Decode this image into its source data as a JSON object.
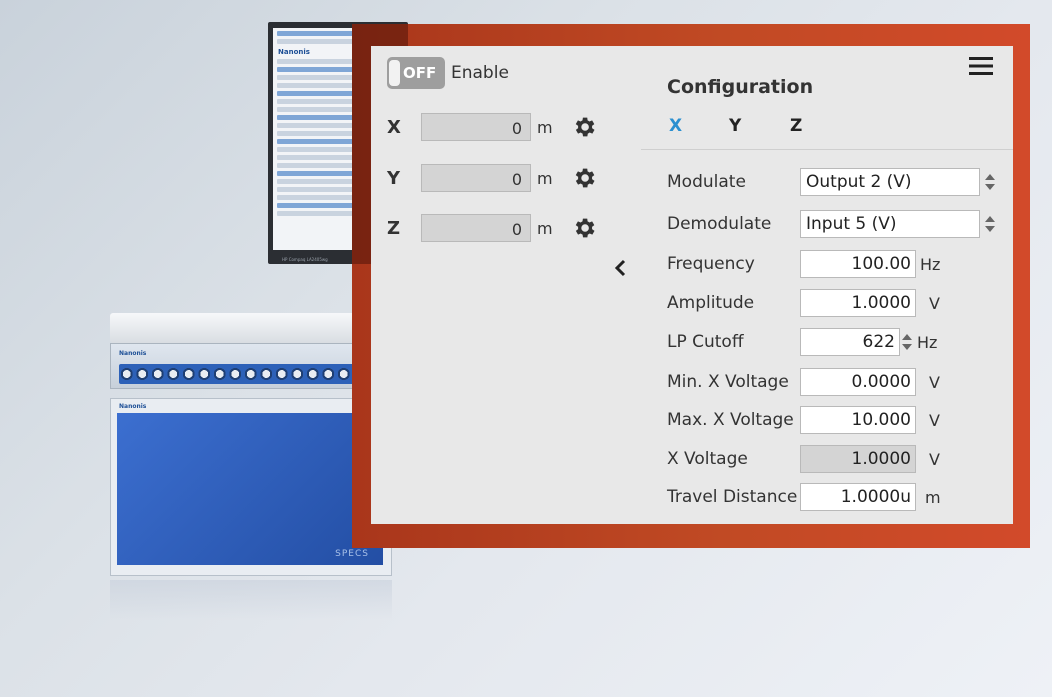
{
  "background": {
    "monitor_brand": "Nanonis",
    "monitor_caption": "HP Compaq LA2405wg",
    "unit_brand": "Nanonis",
    "unit_lower_brand": "Nanonis",
    "unit_logo": "SPECS"
  },
  "colors": {
    "accent": "#2a8fd0",
    "backdrop": "#c14a24",
    "panel": "#e8e8e8"
  },
  "enable": {
    "state": "OFF",
    "label": "Enable"
  },
  "axes": [
    {
      "name": "X",
      "value": "0",
      "unit": "m",
      "icon": "gear-icon"
    },
    {
      "name": "Y",
      "value": "0",
      "unit": "m",
      "icon": "gear-icon"
    },
    {
      "name": "Z",
      "value": "0",
      "unit": "m",
      "icon": "gear-icon"
    }
  ],
  "configuration": {
    "title": "Configuration",
    "tabs": [
      "X",
      "Y",
      "Z"
    ],
    "active_tab": "X",
    "modulate": {
      "label": "Modulate",
      "value": "Output 2 (V)"
    },
    "demodulate": {
      "label": "Demodulate",
      "value": "Input 5 (V)"
    },
    "frequency": {
      "label": "Frequency",
      "value": "100.00",
      "unit": "Hz"
    },
    "amplitude": {
      "label": "Amplitude",
      "value": "1.0000",
      "unit": "V"
    },
    "lp_cutoff": {
      "label": "LP Cutoff",
      "value": "622",
      "unit": "Hz"
    },
    "min_x_voltage": {
      "label": "Min. X Voltage",
      "value": "0.0000",
      "unit": "V"
    },
    "max_x_voltage": {
      "label": "Max. X Voltage",
      "value": "10.000",
      "unit": "V"
    },
    "x_voltage": {
      "label": "X Voltage",
      "value": "1.0000",
      "unit": "V"
    },
    "travel_distance": {
      "label": "Travel Distance",
      "value": "1.0000u",
      "unit": "m"
    }
  }
}
